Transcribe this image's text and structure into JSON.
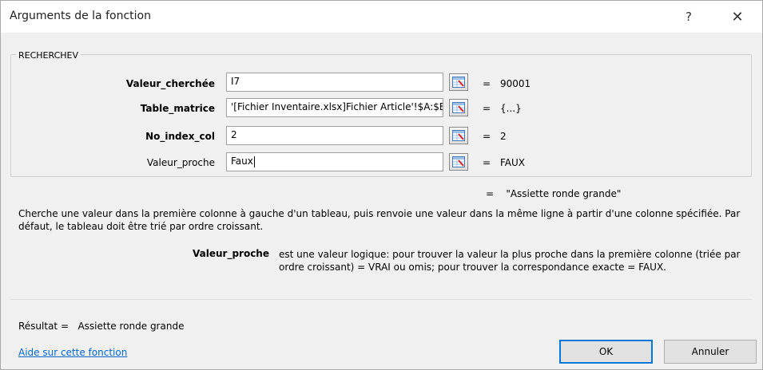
{
  "dialog": {
    "title": "Arguments de la fonction",
    "help_glyph": "?",
    "close_glyph": "✕"
  },
  "function_name": "RECHERCHEV",
  "arguments": [
    {
      "label": "Valeur_cherchée",
      "value": "I7",
      "result": "90001",
      "bold": true
    },
    {
      "label": "Table_matrice",
      "value": "'[Fichier Inventaire.xlsx]Fichier Article'!$A:$B",
      "result": "{...}",
      "bold": true
    },
    {
      "label": "No_index_col",
      "value": "2",
      "result": "2",
      "bold": true
    },
    {
      "label": "Valeur_proche",
      "value": "Faux",
      "result": "FAUX",
      "bold": false
    }
  ],
  "equals_sign": "=",
  "formula_result": "\"Assiette ronde grande\"",
  "description": "Cherche une valeur dans la première colonne à gauche d'un tableau, puis renvoie une valeur dans la même ligne à partir d'une colonne spécifiée. Par défaut, le tableau doit être trié par ordre croissant.",
  "parameter_help": {
    "name": "Valeur_proche",
    "text": "est une valeur logique: pour trouver la valeur la plus proche dans la première colonne (triée par ordre croissant) = VRAI ou omis; pour trouver la correspondance exacte = FAUX."
  },
  "result_label": "Résultat =",
  "result_value": "Assiette ronde grande",
  "help_link": "Aide sur cette fonction",
  "buttons": {
    "ok": "OK",
    "cancel": "Annuler"
  },
  "icons": {
    "collapse": "range-selector-icon"
  },
  "colors": {
    "link": "#0066cc",
    "default_button_border": "#0078d7"
  }
}
